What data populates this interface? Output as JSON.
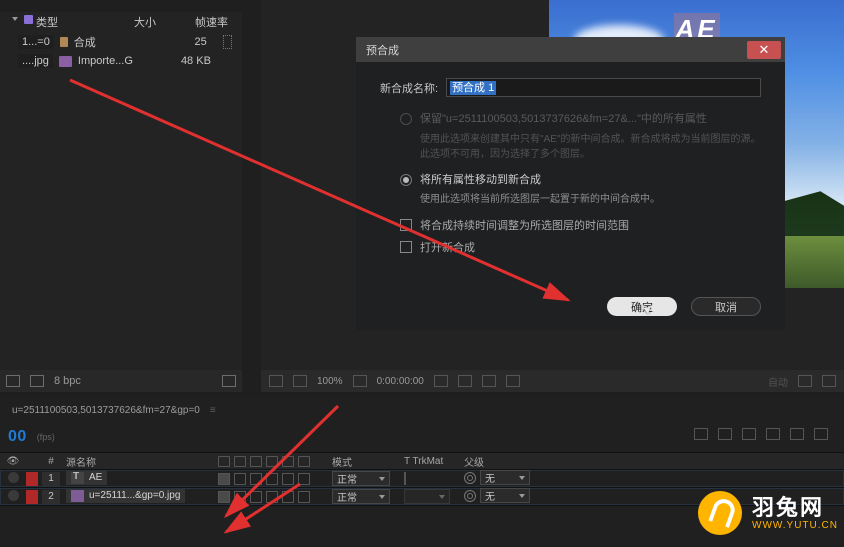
{
  "project": {
    "cols": {
      "name": "类型",
      "size": "大小",
      "rate": "帧速率"
    },
    "rows": [
      {
        "label": "1...=0",
        "iconType": "folder",
        "name": "合成",
        "size": "25"
      },
      {
        "label": "....jpg",
        "iconType": "image",
        "name": "Importe...G",
        "size": "48 KB"
      }
    ],
    "bpc": "8 bpc"
  },
  "preview": {
    "stage_text": "AE",
    "toolbar": {
      "zoom": "100%",
      "time": "0:00:00:00",
      "resolution": "自动"
    }
  },
  "modal": {
    "title": "预合成",
    "name_label": "新合成名称:",
    "name_value": "预合成 1",
    "opt1_label": "保留\"u=2511100503,5013737626&fm=27&...\"中的所有属性",
    "opt1_desc": "使用此选项来创建其中只有\"AE\"的新中间合成。新合成将成为当前图层的源。此选项不可用，因为选择了多个图层。",
    "opt2_label": "将所有属性移动到新合成",
    "opt2_desc": "使用此选项将当前所选图层一起置于新的中间合成中。",
    "check1": "将合成持续时间调整为所选图层的时间范围",
    "check2": "打开新合成",
    "ok": "确定",
    "cancel": "取消"
  },
  "timeline": {
    "tab": "u=2511100503,5013737626&fm=27&gp=0",
    "time": "00",
    "fps_label": "(fps)",
    "cols": {
      "num": "#",
      "source": "源名称",
      "mode": "模式",
      "trk": "T  TrkMat",
      "parent": "父级"
    },
    "mode_default": "正常",
    "parent_none": "无",
    "layers": [
      {
        "num": "1",
        "type": "text",
        "name": "AE"
      },
      {
        "num": "2",
        "type": "img",
        "name": "u=25111...&gp=0.jpg"
      }
    ]
  },
  "watermark": {
    "cn": "羽兔网",
    "url": "WWW.YUTU.CN"
  }
}
